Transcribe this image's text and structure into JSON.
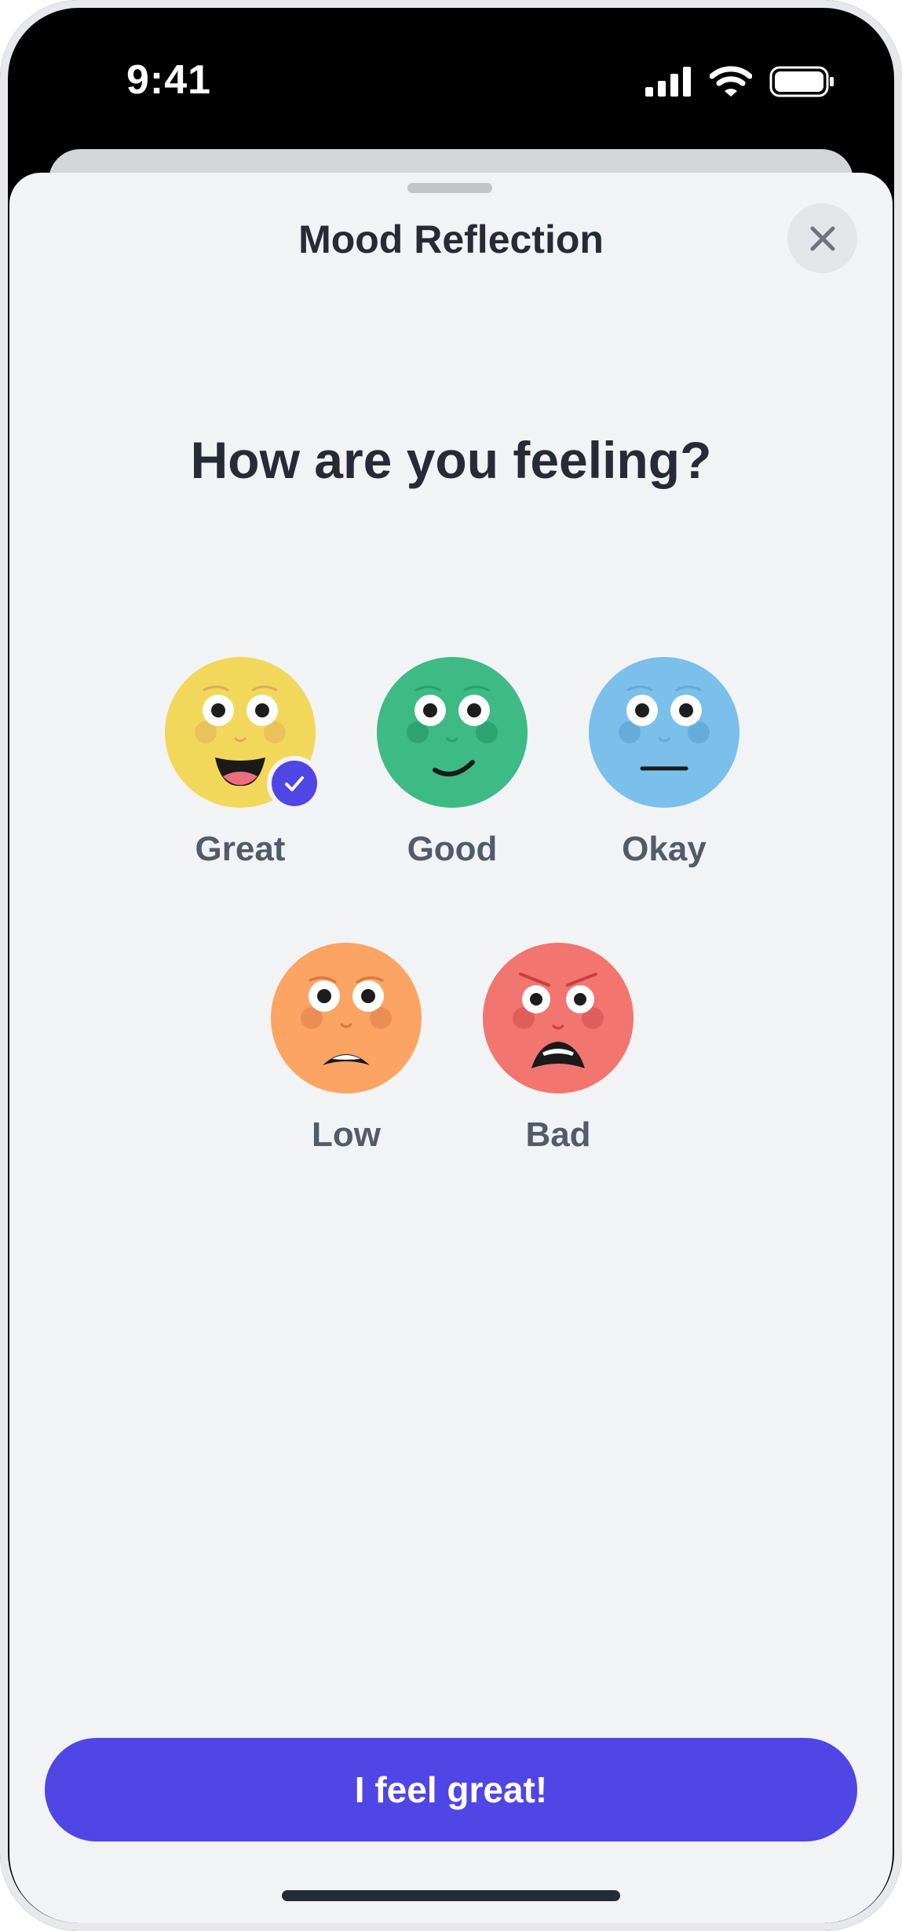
{
  "status_bar": {
    "time": "9:41"
  },
  "sheet": {
    "title": "Mood Reflection",
    "question": "How are you feeling?"
  },
  "moods": [
    {
      "label": "Great",
      "color": "#f2d85a",
      "selected": true
    },
    {
      "label": "Good",
      "color": "#3dba85",
      "selected": false
    },
    {
      "label": "Okay",
      "color": "#7bbfeb",
      "selected": false
    },
    {
      "label": "Low",
      "color": "#fba463",
      "selected": false
    },
    {
      "label": "Bad",
      "color": "#f27570",
      "selected": false
    }
  ],
  "cta": {
    "label": "I feel great!"
  },
  "colors": {
    "accent": "#5046e5",
    "background": "#f2f3f5",
    "text": "#262b36"
  }
}
